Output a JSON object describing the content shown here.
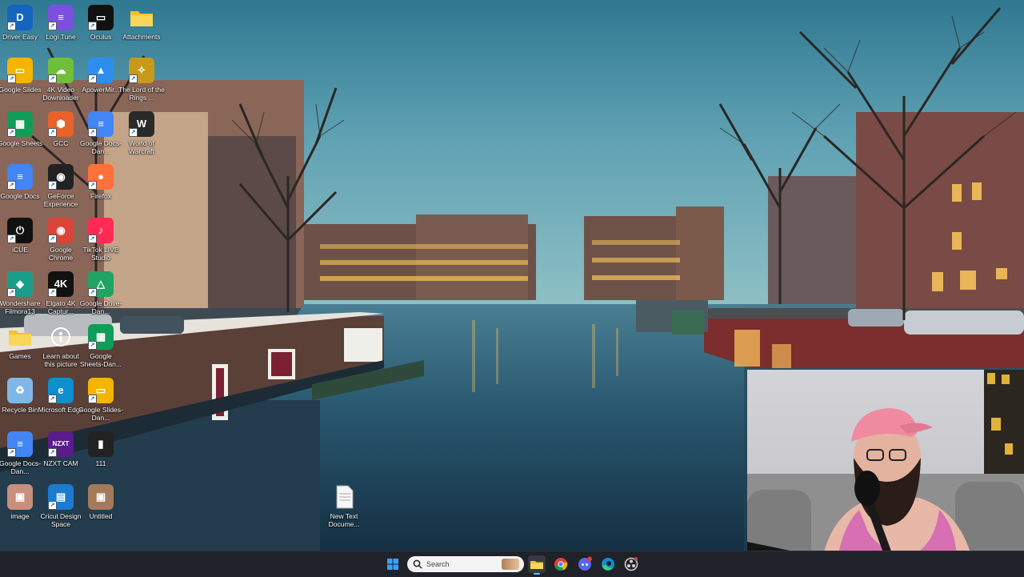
{
  "desktop": {
    "icons": [
      {
        "label": "Driver Easy",
        "glyph": "D",
        "color": "#1565c0",
        "icon_name": "driver-easy-icon"
      },
      {
        "label": "Logi Tune",
        "glyph": "≡",
        "color": "#7b4fe0",
        "icon_name": "logi-tune-icon"
      },
      {
        "label": "Oculus",
        "glyph": "▭",
        "color": "#111111",
        "icon_name": "oculus-icon"
      },
      {
        "label": "Attachments",
        "glyph": "",
        "color": "#f2c230",
        "icon_name": "folder-icon"
      },
      {
        "label": "Google Slides",
        "glyph": "▭",
        "color": "#f4b400",
        "icon_name": "google-slides-icon"
      },
      {
        "label": "4K Video Downloader",
        "glyph": "☁",
        "color": "#6fbf3a",
        "icon_name": "4k-video-downloader-icon"
      },
      {
        "label": "ApowerMir...",
        "glyph": "▲",
        "color": "#2e8ef0",
        "icon_name": "apowermirror-icon"
      },
      {
        "label": "The Lord of the Rings ...",
        "glyph": "✧",
        "color": "#c79a1a",
        "icon_name": "lotr-icon"
      },
      {
        "label": "Google Sheets",
        "glyph": "▦",
        "color": "#0f9d58",
        "icon_name": "google-sheets-icon"
      },
      {
        "label": "GCC",
        "glyph": "⬢",
        "color": "#e8622a",
        "icon_name": "gcc-icon"
      },
      {
        "label": "Google Docs-Dan...",
        "glyph": "≡",
        "color": "#4285f4",
        "icon_name": "google-docs-icon"
      },
      {
        "label": "World of Warcraft",
        "glyph": "W",
        "color": "#2a2a2a",
        "icon_name": "world-of-warcraft-icon"
      },
      {
        "label": "Google Docs",
        "glyph": "≡",
        "color": "#4285f4",
        "icon_name": "google-docs-icon"
      },
      {
        "label": "GeForce Experience",
        "glyph": "◉",
        "color": "#222222",
        "icon_name": "geforce-experience-icon"
      },
      {
        "label": "Firefox",
        "glyph": "●",
        "color": "#ff7139",
        "icon_name": "firefox-icon"
      },
      {
        "label": "iCUE",
        "glyph": "⏻",
        "color": "#111111",
        "icon_name": "icue-icon"
      },
      {
        "label": "Google Chrome",
        "glyph": "◉",
        "color": "#db4437",
        "icon_name": "chrome-icon"
      },
      {
        "label": "TikTok LIVE Studio",
        "glyph": "♪",
        "color": "#fe2c55",
        "icon_name": "tiktok-live-studio-icon"
      },
      {
        "label": "Wondershare Filmora13",
        "glyph": "◆",
        "color": "#1a9e8a",
        "icon_name": "filmora-icon"
      },
      {
        "label": "Elgato 4K Captur...",
        "glyph": "4K",
        "color": "#111111",
        "icon_name": "elgato-4k-capture-icon"
      },
      {
        "label": "Google Drive-Dan...",
        "glyph": "△",
        "color": "#1fa463",
        "icon_name": "google-drive-icon"
      },
      {
        "label": "Games",
        "glyph": "",
        "color": "#f2c230",
        "icon_name": "folder-icon"
      },
      {
        "label": "Learn about this picture",
        "glyph": "ⓘ",
        "color": "transparent",
        "icon_name": "learn-about-picture-icon"
      },
      {
        "label": "Google Sheets-Dan...",
        "glyph": "▦",
        "color": "#0f9d58",
        "icon_name": "google-sheets-icon"
      },
      {
        "label": "Recycle Bin",
        "glyph": "♻",
        "color": "#7fb7e6",
        "icon_name": "recycle-bin-icon"
      },
      {
        "label": "Microsoft Edge",
        "glyph": "e",
        "color": "#0c8fcf",
        "icon_name": "edge-icon"
      },
      {
        "label": "Google Slides-Dan...",
        "glyph": "▭",
        "color": "#f4b400",
        "icon_name": "google-slides-icon"
      },
      {
        "label": "Google Docs-Dan...",
        "glyph": "≡",
        "color": "#4285f4",
        "icon_name": "google-docs-icon"
      },
      {
        "label": "NZXT CAM",
        "glyph": "NZXT",
        "color": "#5b1b8c",
        "icon_name": "nzxt-cam-icon"
      },
      {
        "label": "111",
        "glyph": "▮",
        "color": "#222222",
        "icon_name": "file-111-icon"
      },
      {
        "label": "image",
        "glyph": "▣",
        "color": "#c98f7d",
        "icon_name": "image-file-icon"
      },
      {
        "label": "Cricut Design Space",
        "glyph": "▤",
        "color": "#1b7bd1",
        "icon_name": "cricut-design-space-icon"
      },
      {
        "label": "Untitled",
        "glyph": "▣",
        "color": "#a47a5a",
        "icon_name": "untitled-image-icon"
      },
      {
        "label": "New Text Docume...",
        "glyph": "",
        "color": "#f7f7f7",
        "icon_name": "text-document-icon"
      }
    ]
  },
  "taskbar": {
    "search_placeholder": "Search",
    "items": [
      {
        "name": "start-button",
        "icon_name": "windows-icon",
        "color": "#3aa0ff"
      },
      {
        "name": "file-explorer",
        "icon_name": "file-explorer-icon",
        "color": "#f2c230"
      },
      {
        "name": "chrome",
        "icon_name": "chrome-icon",
        "color": "#db4437"
      },
      {
        "name": "discord",
        "icon_name": "discord-icon",
        "color": "#5865f2"
      },
      {
        "name": "edge",
        "icon_name": "edge-icon",
        "color": "#0c8fcf"
      },
      {
        "name": "obs",
        "icon_name": "obs-icon",
        "color": "#bbbbbb"
      }
    ]
  },
  "colors": {
    "sky": "#4d93a9",
    "taskbar": "#1f2228",
    "folder": "#f2c230",
    "window_light": "#f5c35c"
  }
}
